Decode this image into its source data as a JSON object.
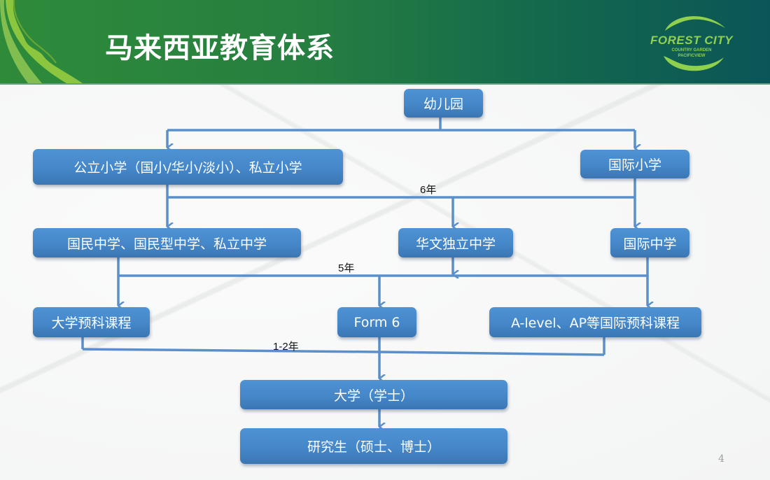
{
  "slide": {
    "title": "马来西亚教育体系",
    "page_number": "4"
  },
  "logo": {
    "main": "FOREST CITY",
    "sub_line1": "COUNTRY GARDEN",
    "sub_line2": "PACIFICVIEW"
  },
  "colors": {
    "header_green": "#2e8b3a",
    "header_teal": "#0b5558",
    "node_blue": "#4587c9",
    "connector_blue": "#5b8fca",
    "logo_green": "#8fd14f"
  },
  "nodes": {
    "kindergarten": "幼儿园",
    "public_primary": "公立小学（国小/华小/淡小）、私立小学",
    "intl_primary": "国际小学",
    "national_secondary": "国民中学、国民型中学、私立中学",
    "chinese_independent": "华文独立中学",
    "intl_secondary": "国际中学",
    "foundation": "大学预科课程",
    "form6": "Form 6",
    "alevel": "A-level、AP等国际预科课程",
    "university": "大学（学士）",
    "postgraduate": "研究生（硕士、博士）"
  },
  "durations": {
    "primary": "6年",
    "secondary": "5年",
    "preuniversity": "1-2年"
  }
}
